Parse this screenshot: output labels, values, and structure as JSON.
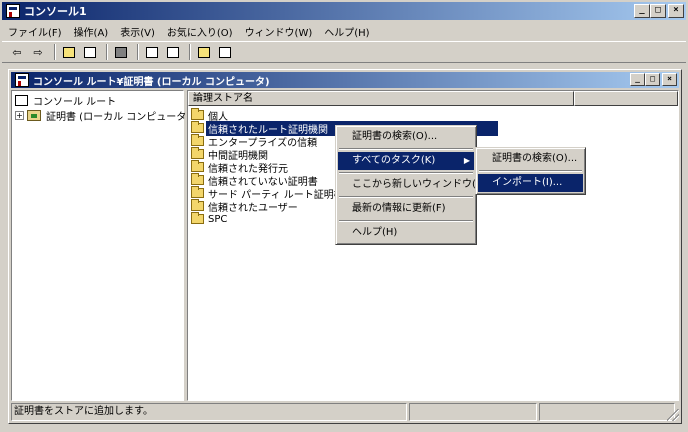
{
  "app": {
    "title": "コンソール1",
    "btn_min": "_",
    "btn_max": "□",
    "btn_close": "×"
  },
  "menu": [
    "ファイル(F)",
    "操作(A)",
    "表示(V)",
    "お気に入り(O)",
    "ウィンドウ(W)",
    "ヘルプ(H)"
  ],
  "toolbar": {
    "back": "⇦",
    "forward": "⇨"
  },
  "inner": {
    "title": "コンソール ルート¥証明書 (ローカル コンピュータ)"
  },
  "tree": {
    "root": "コンソール ルート",
    "child": "証明書 (ローカル コンピュータ)",
    "expander": "+"
  },
  "list": {
    "column": "論理ストア名",
    "items": [
      "個人",
      "信頼されたルート証明機関",
      "エンタープライズの信頼",
      "中間証明機関",
      "信頼された発行元",
      "信頼されていない証明書",
      "サード パーティ ルート証明機関",
      "信頼されたユーザー",
      "SPC"
    ]
  },
  "context_menu": {
    "find": "証明書の検索(O)...",
    "all_tasks": "すべてのタスク(K)",
    "all_tasks_arrow": "▶",
    "new_window": "ここから新しいウィンドウ(W)",
    "refresh": "最新の情報に更新(F)",
    "help": "ヘルプ(H)"
  },
  "submenu": {
    "find": "証明書の検索(O)...",
    "import": "インポート(I)..."
  },
  "status": {
    "text": "証明書をストアに追加します。"
  }
}
